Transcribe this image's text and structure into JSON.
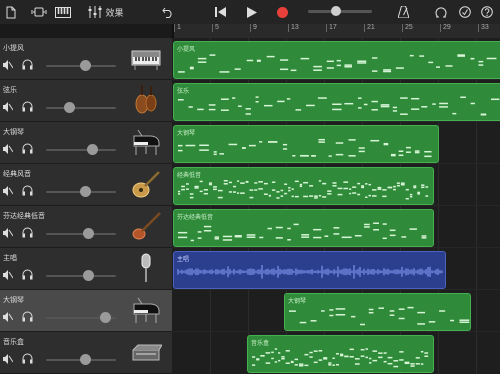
{
  "toolbar": {
    "effects_label": "效果",
    "icons": [
      "document-icon",
      "view-toggle-icon",
      "keyboard-icon",
      "mixer-icon",
      "undo-icon",
      "rewind-icon",
      "play-icon",
      "record-icon",
      "metronome-icon",
      "loop-icon",
      "settings-icon",
      "help-icon"
    ],
    "record_color": "#e8413b"
  },
  "ruler": {
    "bars": [
      "1",
      "5",
      "9",
      "13",
      "17",
      "21",
      "25",
      "29",
      "33"
    ]
  },
  "tracks": [
    {
      "name": "小提风",
      "volume": 0.57,
      "selected": false,
      "instrument": "keyboard-icon"
    },
    {
      "name": "弦乐",
      "volume": 0.31,
      "selected": false,
      "instrument": "strings-icon"
    },
    {
      "name": "大钢琴",
      "volume": 0.67,
      "selected": false,
      "instrument": "grand-piano-icon"
    },
    {
      "name": "经典风音",
      "volume": 0.57,
      "selected": false,
      "instrument": "electric-guitar-icon"
    },
    {
      "name": "芬达经典低音",
      "volume": 0.62,
      "selected": false,
      "instrument": "bass-guitar-icon"
    },
    {
      "name": "主唱",
      "volume": 0.62,
      "selected": false,
      "instrument": "microphone-icon"
    },
    {
      "name": "大钢琴",
      "volume": 0.85,
      "selected": true,
      "instrument": "grand-piano-icon"
    },
    {
      "name": "音乐盒",
      "volume": 0.57,
      "selected": false,
      "instrument": "music-box-icon"
    }
  ],
  "regions": [
    {
      "label": "小提风",
      "color": "green"
    },
    {
      "label": "弦乐",
      "color": "green"
    },
    {
      "label": "大钢琴",
      "color": "green"
    },
    {
      "label": "经典低音",
      "color": "green"
    },
    {
      "label": "芬达经典低音",
      "color": "green"
    },
    {
      "label": "主唱",
      "color": "blue"
    },
    {
      "label": "大钢琴",
      "color": "green"
    },
    {
      "label": "音乐盒",
      "color": "green"
    }
  ],
  "colors": {
    "region_green": "#2f8a39",
    "region_blue": "#2b3f8e",
    "selected_track": "#4a4a4a"
  }
}
